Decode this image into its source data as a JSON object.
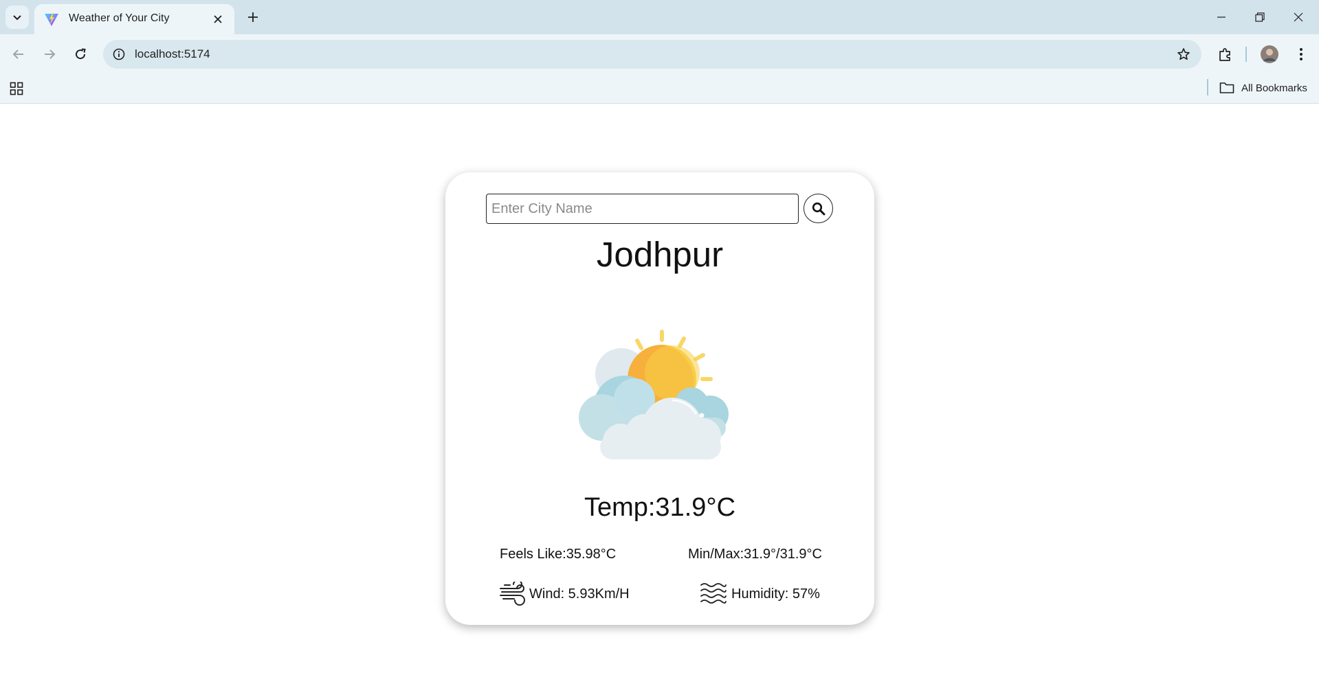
{
  "browser": {
    "tab": {
      "title": "Weather of Your City"
    },
    "address_bar": {
      "url": "localhost:5174"
    },
    "bookmarks_bar": {
      "all_bookmarks_label": "All Bookmarks"
    }
  },
  "app": {
    "search": {
      "placeholder": "Enter City Name",
      "value": ""
    },
    "city": "Jodhpur",
    "weather_icon": "partly-cloudy-sun-icon",
    "temperature_text": "Temp:31.9°C",
    "feels_like_text": "Feels Like:35.98°C",
    "min_max_text": "Min/Max:31.9°/31.9°C",
    "wind_text": "Wind: 5.93Km/H",
    "humidity_text": "Humidity: 57%"
  },
  "colors": {
    "tabstrip_bg": "#d3e3ec",
    "toolbar_bg": "#eef5f9",
    "omnibox_bg": "#d9e7ee",
    "sun_orange": "#f7b03b",
    "sun_yellow": "#f8cf48",
    "cloud_light": "#e7eef2",
    "cloud_blue": "#a8d5df"
  }
}
